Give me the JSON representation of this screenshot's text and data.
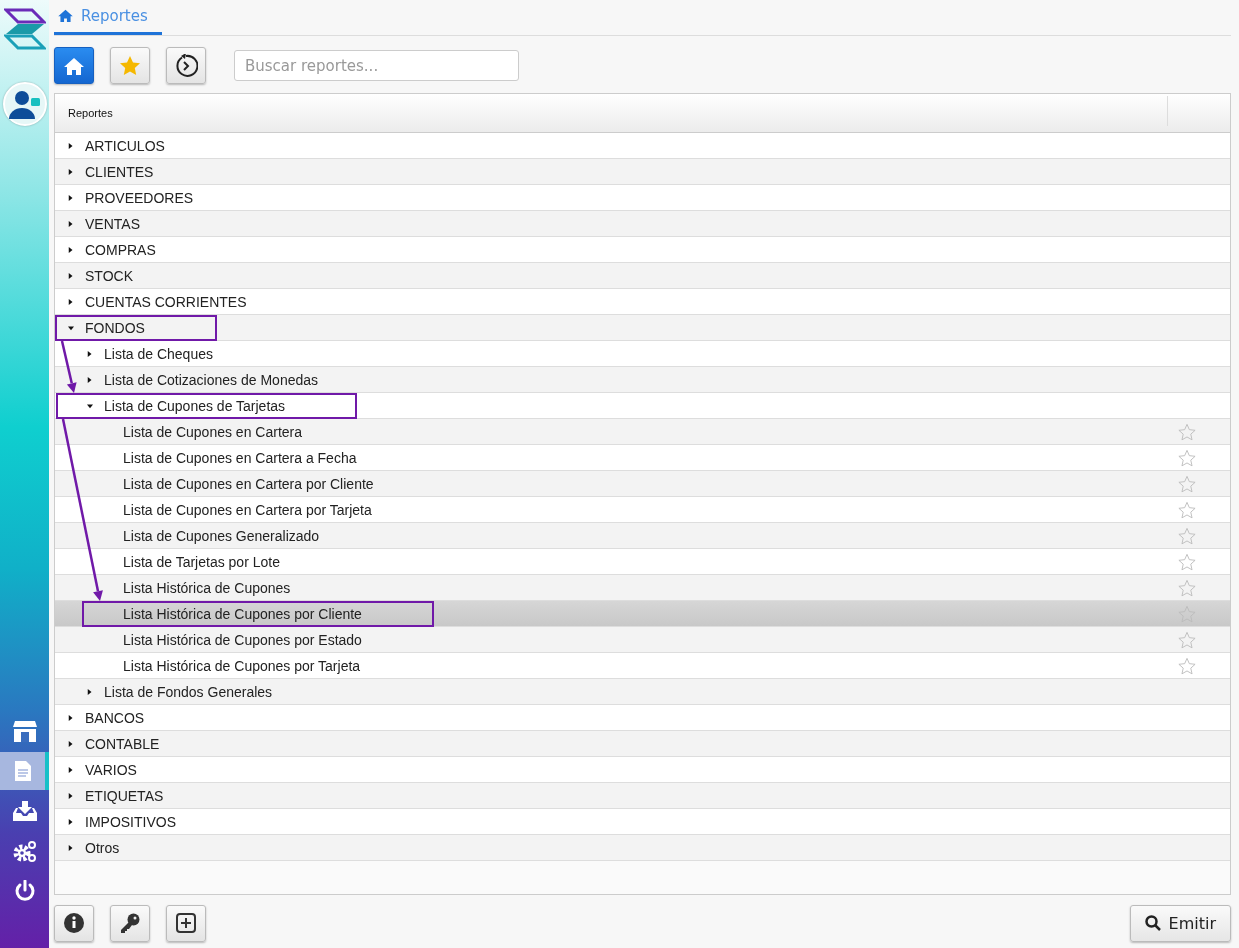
{
  "sidebar": {
    "items": [
      {
        "kind": "store",
        "selected": false
      },
      {
        "kind": "document",
        "selected": true
      },
      {
        "kind": "download",
        "selected": false
      },
      {
        "kind": "gears",
        "selected": false
      },
      {
        "kind": "power",
        "selected": false
      }
    ]
  },
  "tabs": [
    {
      "label": "Reportes",
      "selected": true
    }
  ],
  "toolbar": [
    {
      "kind": "home",
      "selected": true
    },
    {
      "kind": "star",
      "selected": false
    },
    {
      "kind": "history",
      "selected": false
    }
  ],
  "search": {
    "placeholder": "Buscar reportes..."
  },
  "table": {
    "columns": [
      "Reportes"
    ],
    "tree": [
      {
        "label": "ARTICULOS",
        "expanded": false
      },
      {
        "label": "CLIENTES",
        "expanded": false
      },
      {
        "label": "PROVEEDORES",
        "expanded": false
      },
      {
        "label": "VENTAS",
        "expanded": false
      },
      {
        "label": "COMPRAS",
        "expanded": false
      },
      {
        "label": "STOCK",
        "expanded": false
      },
      {
        "label": "CUENTAS CORRIENTES",
        "expanded": false
      },
      {
        "label": "FONDOS",
        "expanded": true,
        "highlighted": true,
        "children": [
          {
            "label": "Lista de Cheques",
            "expanded": false
          },
          {
            "label": "Lista de Cotizaciones de Monedas",
            "expanded": false
          },
          {
            "label": "Lista de Cupones de Tarjetas",
            "expanded": true,
            "highlighted": true,
            "children": [
              {
                "label": "Lista de Cupones en Cartera",
                "favorite": false
              },
              {
                "label": "Lista de Cupones en Cartera a Fecha",
                "favorite": false
              },
              {
                "label": "Lista de Cupones en Cartera por Cliente",
                "favorite": false
              },
              {
                "label": "Lista de Cupones en Cartera por Tarjeta",
                "favorite": false
              },
              {
                "label": "Lista de Cupones Generalizado",
                "favorite": false
              },
              {
                "label": "Lista de Tarjetas por Lote",
                "favorite": false
              },
              {
                "label": "Lista Histórica de Cupones",
                "favorite": false
              },
              {
                "label": "Lista Histórica de Cupones por Cliente",
                "favorite": false,
                "selected": true,
                "highlighted": true
              },
              {
                "label": "Lista Histórica de Cupones por Estado",
                "favorite": false
              },
              {
                "label": "Lista Histórica de Cupones por Tarjeta",
                "favorite": false
              }
            ]
          },
          {
            "label": "Lista de Fondos Generales",
            "expanded": false
          }
        ]
      },
      {
        "label": "BANCOS",
        "expanded": false
      },
      {
        "label": "CONTABLE",
        "expanded": false
      },
      {
        "label": "VARIOS",
        "expanded": false
      },
      {
        "label": "ETIQUETAS",
        "expanded": false
      },
      {
        "label": "IMPOSITIVOS",
        "expanded": false
      },
      {
        "label": "Otros",
        "expanded": false
      }
    ]
  },
  "footer": {
    "tools": [
      {
        "kind": "info"
      },
      {
        "kind": "key"
      },
      {
        "kind": "add"
      }
    ],
    "emit_button": "Emitir"
  }
}
